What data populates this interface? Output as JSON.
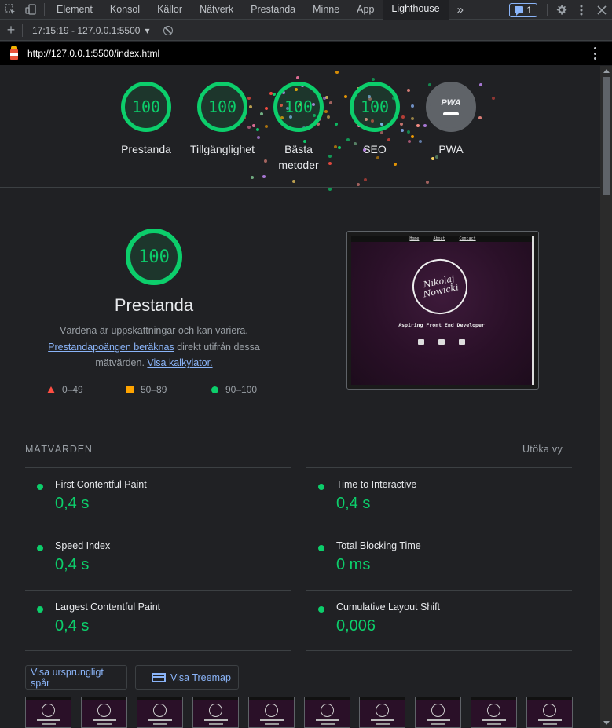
{
  "devtools": {
    "tabs": [
      "Element",
      "Konsol",
      "Källor",
      "Nätverk",
      "Prestanda",
      "Minne",
      "App",
      "Lighthouse"
    ],
    "active_tab": "Lighthouse",
    "more_tabs": "»",
    "issues_count": "1"
  },
  "lighthouse_toolbar": {
    "add": "+",
    "report_select": "17:15:19 - 127.0.0.1:5500",
    "dropdown_arrow": "▾"
  },
  "url_bar": {
    "url": "http://127.0.0.1:5500/index.html"
  },
  "scores": [
    {
      "label": "Prestanda",
      "score": "100"
    },
    {
      "label": "Tillgänglighet",
      "score": "100"
    },
    {
      "label": "Bästa metoder",
      "label_line1": "Bästa",
      "label_line2": "metoder",
      "score": "100"
    },
    {
      "label": "SEO",
      "score": "100"
    },
    {
      "label": "PWA",
      "badge": "PWA",
      "score": "—"
    }
  ],
  "performance": {
    "score": "100",
    "title": "Prestanda",
    "desc_line1": "Värdena är uppskattningar och kan variera.",
    "desc_link1": "Prestandapoängen beräknas",
    "desc_line2_rest": " direkt utifrån dessa",
    "desc_line3_start": "mätvärden. ",
    "desc_link2": "Visa kalkylator.",
    "legend": [
      {
        "range": "0–49",
        "shape": "triangle",
        "color": "#ff4e42"
      },
      {
        "range": "50–89",
        "shape": "square",
        "color": "#ffa400"
      },
      {
        "range": "90–100",
        "shape": "circle",
        "color": "#0cce6b"
      }
    ]
  },
  "screenshot": {
    "nav": [
      "Home",
      "About",
      "Contact"
    ],
    "logo_line1": "Nikolaj",
    "logo_line2": "Nowicki",
    "tagline": "Aspiring Front End Developer"
  },
  "metrics": {
    "header": "MÄTVÄRDEN",
    "expand": "Utöka vy",
    "items": [
      {
        "name": "First Contentful Paint",
        "value": "0,4 s"
      },
      {
        "name": "Time to Interactive",
        "value": "0,4 s"
      },
      {
        "name": "Speed Index",
        "value": "0,4 s"
      },
      {
        "name": "Total Blocking Time",
        "value": "0 ms"
      },
      {
        "name": "Largest Contentful Paint",
        "value": "0,4 s"
      },
      {
        "name": "Cumulative Layout Shift",
        "value": "0,006"
      }
    ],
    "status_color": "#0cce6b"
  },
  "buttons": {
    "original_trace": "Visa ursprungligt spår",
    "treemap": "Visa Treemap"
  },
  "colors": {
    "pass": "#0cce6b",
    "link": "#8ab4f8",
    "background": "#202124"
  }
}
